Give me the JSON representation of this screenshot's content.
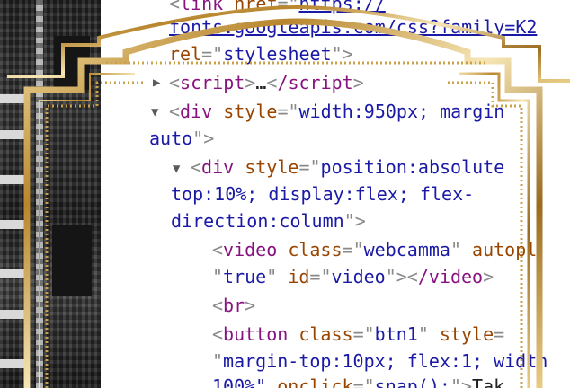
{
  "colors": {
    "tag": "#881280",
    "attribute": "#994500",
    "value": "#1a1aa6",
    "bracket": "#8a8a8a",
    "frame_gold": "#c9a14a"
  },
  "icons": {
    "collapsed": "triangle-right-icon",
    "expanded": "triangle-down-icon"
  },
  "dom": {
    "link_line1": {
      "tag": "link",
      "attr": "href",
      "url": "https://"
    },
    "link_line2": {
      "url": "fonts.googleapis.com/css?family=K2"
    },
    "link_line3": {
      "attr": "rel",
      "value": "stylesheet"
    },
    "script_node": {
      "tag": "script",
      "ellipsis": "…",
      "close": "/script"
    },
    "div1_line1": {
      "tag": "div",
      "attr": "style",
      "value": "width:950px; margin"
    },
    "div1_line2": {
      "value": "auto"
    },
    "div2_line1": {
      "tag": "div",
      "attr": "style",
      "value": "position:absolute"
    },
    "div2_line2": {
      "value": "top:10%; display:flex; flex-"
    },
    "div2_line3": {
      "value": "direction:column"
    },
    "video_line1": {
      "tag": "video",
      "attr1": "class",
      "val1": "webcamma",
      "attr2": "autopl"
    },
    "video_line2": {
      "val2": "true",
      "attr3": "id",
      "val3": "video",
      "close": "/video"
    },
    "br": {
      "tag": "br"
    },
    "button_line1": {
      "tag": "button",
      "attr1": "class",
      "val1": "btn1",
      "attr2": "style"
    },
    "button_line2": {
      "value": "margin-top:10px; flex:1; width"
    },
    "button_line3": {
      "value": "100%\"",
      "attr": "onclick",
      "val": "snap();",
      "text": "Tak"
    }
  }
}
